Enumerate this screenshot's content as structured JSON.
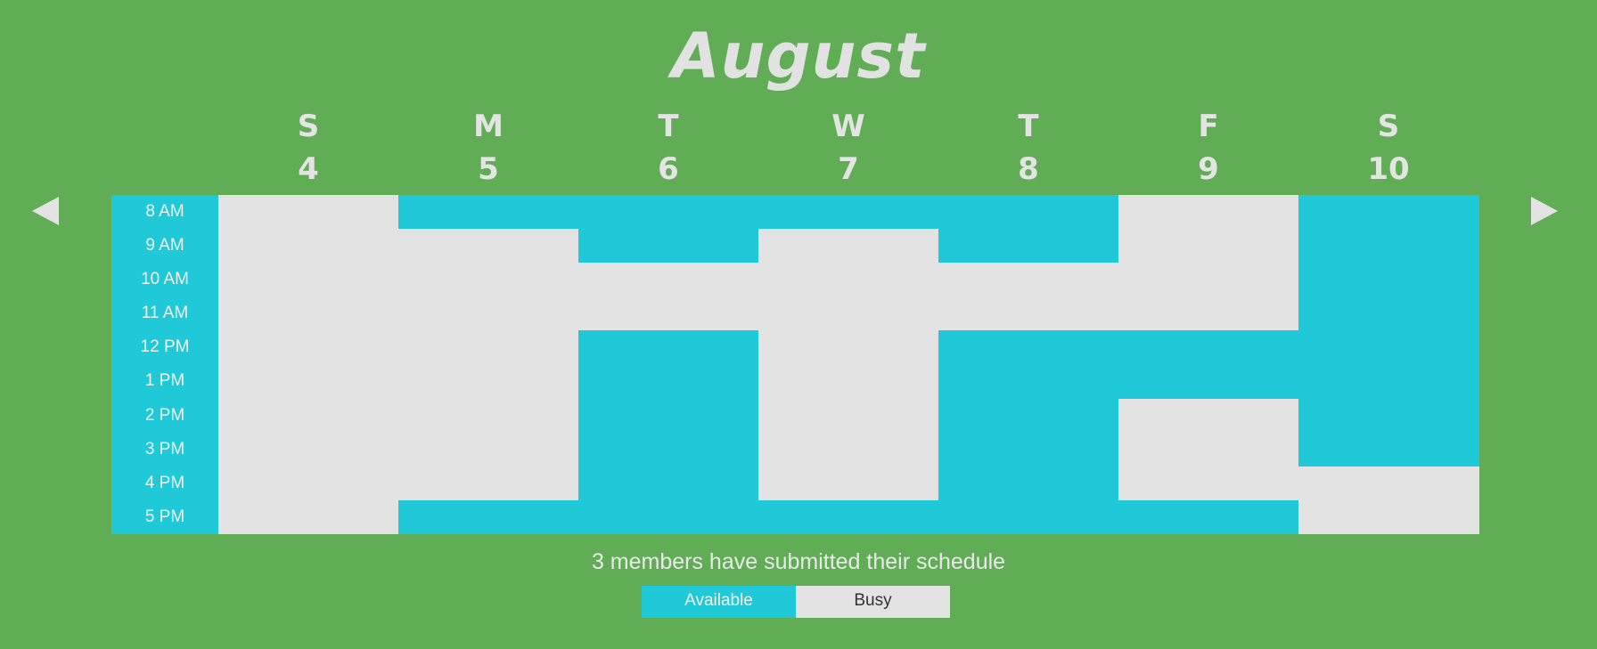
{
  "title": "August",
  "days": [
    {
      "letter": "S",
      "num": "4"
    },
    {
      "letter": "M",
      "num": "5"
    },
    {
      "letter": "T",
      "num": "6"
    },
    {
      "letter": "W",
      "num": "7"
    },
    {
      "letter": "T",
      "num": "8"
    },
    {
      "letter": "F",
      "num": "9"
    },
    {
      "letter": "S",
      "num": "10"
    }
  ],
  "times": [
    "8 AM",
    "9 AM",
    "10 AM",
    "11 AM",
    "12 PM",
    "1 PM",
    "2 PM",
    "3 PM",
    "4 PM",
    "5 PM"
  ],
  "availability": [
    [
      "B",
      "A",
      "A",
      "A",
      "A",
      "B",
      "A"
    ],
    [
      "B",
      "B",
      "A",
      "B",
      "A",
      "B",
      "A"
    ],
    [
      "B",
      "B",
      "B",
      "B",
      "B",
      "B",
      "A"
    ],
    [
      "B",
      "B",
      "B",
      "B",
      "B",
      "B",
      "A"
    ],
    [
      "B",
      "B",
      "A",
      "B",
      "A",
      "A",
      "A"
    ],
    [
      "B",
      "B",
      "A",
      "B",
      "A",
      "A",
      "A"
    ],
    [
      "B",
      "B",
      "A",
      "B",
      "A",
      "B",
      "A"
    ],
    [
      "B",
      "B",
      "A",
      "B",
      "A",
      "B",
      "A"
    ],
    [
      "B",
      "B",
      "A",
      "B",
      "A",
      "B",
      "B"
    ],
    [
      "B",
      "A",
      "A",
      "A",
      "A",
      "A",
      "B"
    ]
  ],
  "status": "3 members have submitted their schedule",
  "legend": {
    "available": "Available",
    "busy": "Busy"
  },
  "colors": {
    "available": "#1fc9d8",
    "busy": "#e3e3e3",
    "background": "#61ad56"
  },
  "nav": {
    "prev_icon": "left-triangle-icon",
    "next_icon": "right-triangle-icon"
  }
}
